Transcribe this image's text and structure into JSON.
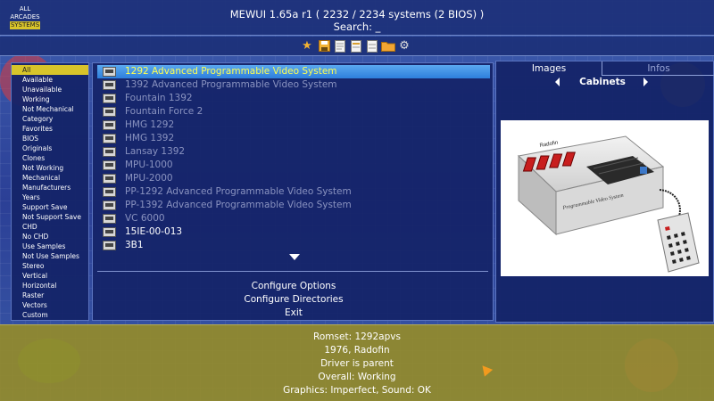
{
  "header": {
    "badge_line1": "ALL",
    "badge_line2": "ARCADES",
    "badge_line3": "SYSTEMS",
    "title": "MEWUI 1.65a r1 ( 2232 / 2234 systems (2 BIOS) )",
    "search": "Search: _"
  },
  "toolbar": {
    "icons": [
      "star-icon",
      "save-icon",
      "document-icon",
      "document-list-icon",
      "document-edit-icon",
      "folder-icon",
      "gear-icon"
    ]
  },
  "filters": {
    "items": [
      "All",
      "Available",
      "Unavailable",
      "Working",
      "Not Mechanical",
      "Category",
      "Favorites",
      "BIOS",
      "Originals",
      "Clones",
      "Not Working",
      "Mechanical",
      "Manufacturers",
      "Years",
      "Support Save",
      "Not Support Save",
      "CHD",
      "No CHD",
      "Use Samples",
      "Not Use Samples",
      "Stereo",
      "Vertical",
      "Horizontal",
      "Raster",
      "Vectors",
      "Custom"
    ]
  },
  "game_list": {
    "rows": [
      "1292 Advanced Programmable Video System",
      "1392 Advanced Programmable Video System",
      "Fountain 1392",
      "Fountain Force 2",
      "HMG 1292",
      "HMG 1392",
      "Lansay 1392",
      "MPU-1000",
      "MPU-2000",
      "PP-1292 Advanced Programmable Video System",
      "PP-1392 Advanced Programmable Video System",
      "VC 6000",
      "15IE-00-013",
      "3B1"
    ]
  },
  "menu": {
    "configure_options": "Configure Options",
    "configure_directories": "Configure Directories",
    "exit": "Exit"
  },
  "right_panel": {
    "tab_images": "Images",
    "tab_infos": "Infos",
    "image_type": "Cabinets",
    "image_brand": "Radofin",
    "image_caption": "Programmable Video System"
  },
  "info": {
    "romset": "Romset: 1292apvs",
    "year_maker": "1976, Radofin",
    "driver": "Driver is parent",
    "overall": "Overall: Working",
    "graphics": "Graphics: Imperfect, Sound: OK"
  },
  "colors": {
    "accent_yellow": "#d8c42a",
    "selection_blue": "#2d7fdc",
    "selected_text": "#ffff50",
    "panel_bg": "#142468",
    "info_bg": "#968c28"
  }
}
